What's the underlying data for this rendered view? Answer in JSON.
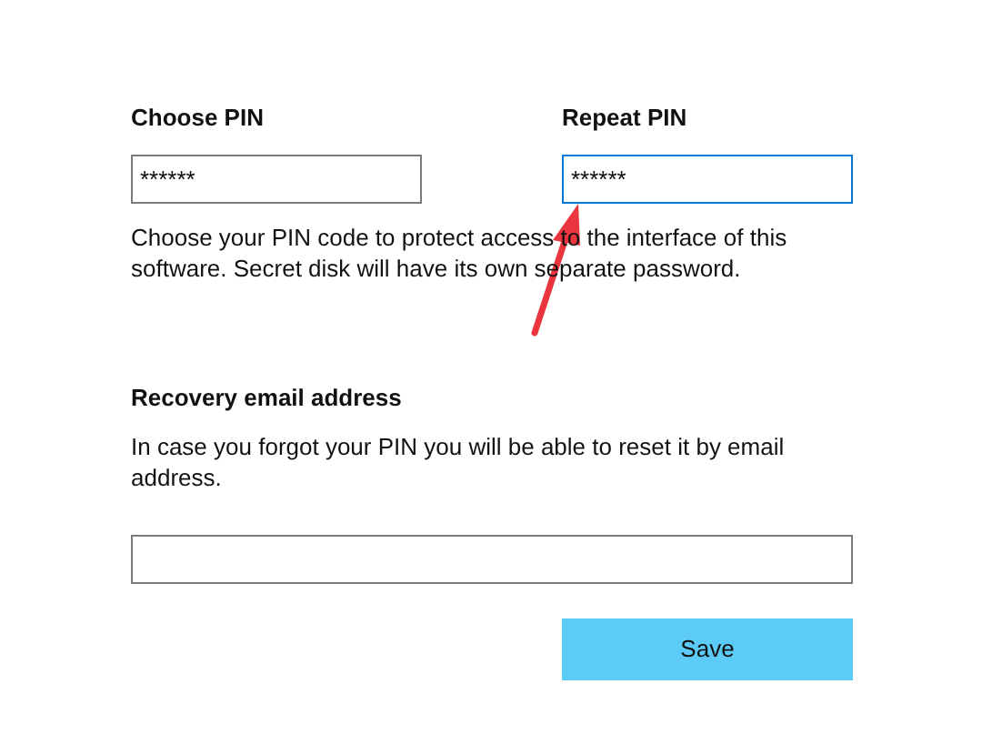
{
  "pin_fields": [
    {
      "label": "Choose PIN",
      "value": "******",
      "focused": false
    },
    {
      "label": "Repeat PIN",
      "value": "******",
      "focused": true
    }
  ],
  "pin_help": "Choose your PIN code to protect access to the interface of this software. Secret disk will have its own separate password.",
  "recovery": {
    "label": "Recovery email address",
    "help": "In case you forgot your PIN you will be able to reset it by email address."
  },
  "buttons": [
    {
      "label": "Save"
    }
  ]
}
